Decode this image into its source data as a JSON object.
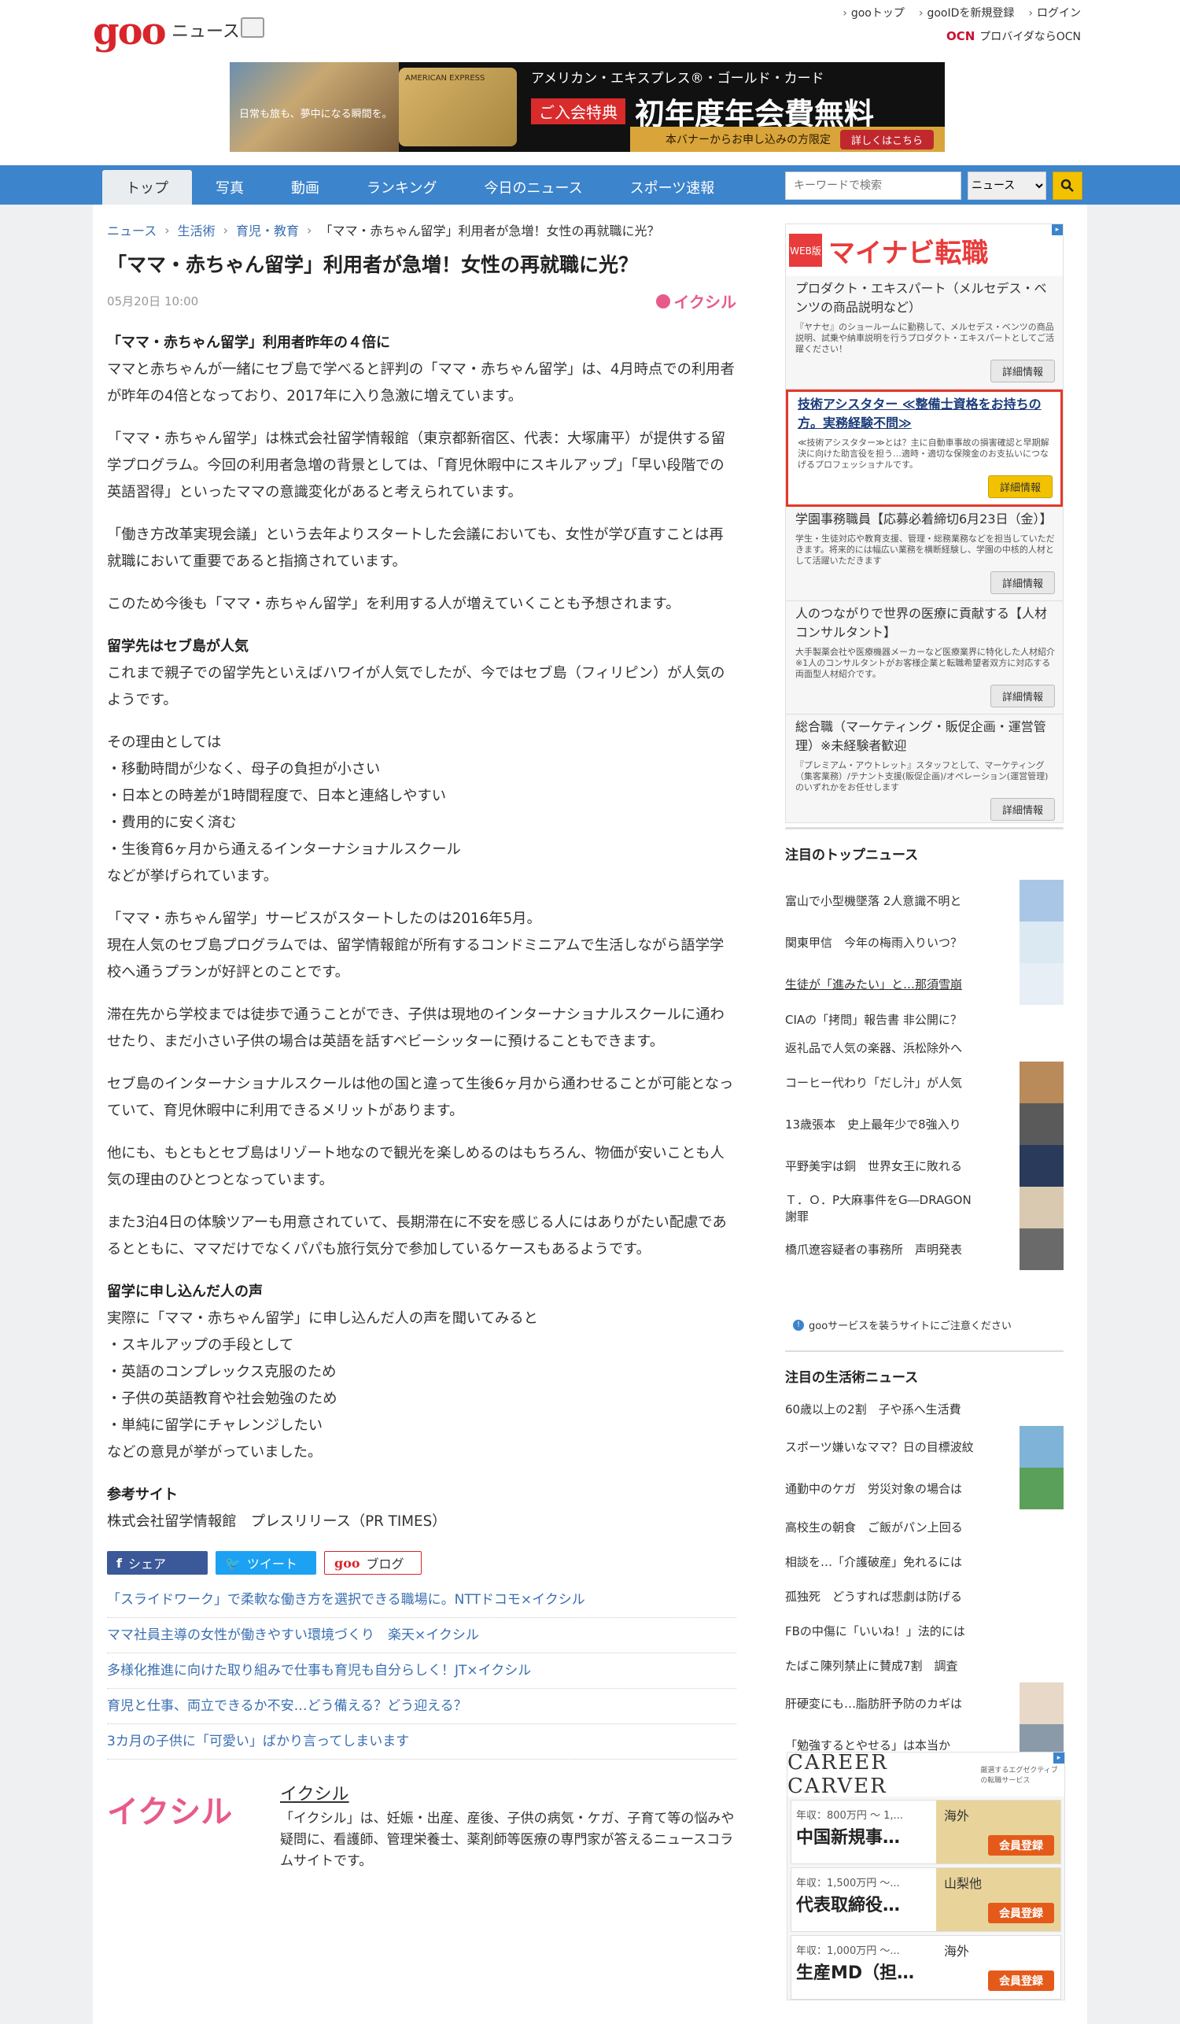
{
  "header": {
    "logo": "goo",
    "section": "ニュース",
    "links": [
      "gooトップ",
      "gooIDを新規登録",
      "ログイン"
    ],
    "ocn_badge": "OCN",
    "ocn_text": "プロバイダならOCN"
  },
  "banner": {
    "img_text": "日常も旅も、夢中になる瞬間を。",
    "card_text": "AMERICAN EXPRESS",
    "line1": "アメリカン・エキスプレス®・ゴールド・カード",
    "tag": "ご入会特典",
    "big": "初年度年会費無料",
    "foot": "本バナーからお申し込みの方限定",
    "button": "詳しくはこちら"
  },
  "nav": {
    "tabs": [
      "トップ",
      "写真",
      "動画",
      "ランキング",
      "今日のニュース",
      "スポーツ速報"
    ],
    "search_placeholder": "キーワードで検索",
    "search_scope": "ニュース"
  },
  "breadcrumb": [
    "ニュース",
    "生活術",
    "育児・教育",
    "「ママ・赤ちゃん留学」利用者が急増！女性の再就職に光？"
  ],
  "article": {
    "title": "「ママ・赤ちゃん留学」利用者が急増！女性の再就職に光？",
    "date": "05月20日 10:00",
    "source": "イクシル",
    "h1": "「ママ・赤ちゃん留学」利用者昨年の４倍に",
    "p1": "ママと赤ちゃんが一緒にセブ島で学べると評判の「ママ・赤ちゃん留学」は、4月時点での利用者が昨年の4倍となっており、2017年に入り急激に増えています。",
    "p2": "「ママ・赤ちゃん留学」は株式会社留学情報館（東京都新宿区、代表：大塚庸平）が提供する留学プログラム。今回の利用者急増の背景としては、「育児休暇中にスキルアップ」「早い段階での英語習得」といったママの意識変化があると考えられています。",
    "p3": "「働き方改革実現会議」という去年よりスタートした会議においても、女性が学び直すことは再就職において重要であると指摘されています。",
    "p4": "このため今後も「ママ・赤ちゃん留学」を利用する人が増えていくことも予想されます。",
    "h2": "留学先はセブ島が人気",
    "p5": "これまで親子での留学先といえばハワイが人気でしたが、今ではセブ島（フィリピン）が人気のようです。",
    "p6_intro": "その理由としては",
    "p6_items": [
      "・移動時間が少なく、母子の負担が小さい",
      "・日本との時差が1時間程度で、日本と連絡しやすい",
      "・費用的に安く済む",
      "・生後育6ヶ月から通えるインターナショナルスクール"
    ],
    "p6_end": "などが挙げられています。",
    "p7a": "「ママ・赤ちゃん留学」サービスがスタートしたのは2016年5月。",
    "p7b": "現在人気のセブ島プログラムでは、留学情報館が所有するコンドミニアムで生活しながら語学学校へ通うプランが好評とのことです。",
    "p8": "滞在先から学校までは徒歩で通うことができ、子供は現地のインターナショナルスクールに通わせたり、まだ小さい子供の場合は英語を話すベビーシッターに預けることもできます。",
    "p9": "セブ島のインターナショナルスクールは他の国と違って生後6ヶ月から通わせることが可能となっていて、育児休暇中に利用できるメリットがあります。",
    "p10": "他にも、もともとセブ島はリゾート地なので観光を楽しめるのはもちろん、物価が安いことも人気の理由のひとつとなっています。",
    "p11": "また3泊4日の体験ツアーも用意されていて、長期滞在に不安を感じる人にはありがたい配慮であるとともに、ママだけでなくパパも旅行気分で参加しているケースもあるようです。",
    "h3": "留学に申し込んだ人の声",
    "p12_intro": "実際に「ママ・赤ちゃん留学」に申し込んだ人の声を聞いてみると",
    "p12_items": [
      "・スキルアップの手段として",
      "・英語のコンプレックス克服のため",
      "・子供の英語教育や社会勉強のため",
      "・単純に留学にチャレンジしたい"
    ],
    "p12_end": "などの意見が挙がっていました。",
    "h4": "参考サイト",
    "ref": "株式会社留学情報館　プレスリリース（PR TIMES）"
  },
  "share": {
    "fb": "シェア",
    "tw": "ツイート",
    "blog_goo": "goo",
    "blog": "ブログ"
  },
  "related": [
    "「スライドワーク」で柔軟な働き方を選択できる職場に。NTTドコモ×イクシル",
    "ママ社員主導の女性が働きやすい環境づくり　楽天×イクシル",
    "多様化推進に向けた取り組みで仕事も育児も自分らしく！JT×イクシル",
    "育児と仕事、両立できるか不安…どう備える？どう迎える？",
    "3カ月の子供に「可愛い」ばかり言ってしまいます"
  ],
  "about": {
    "logo": "イクシル",
    "name": "イクシル",
    "desc": "「イクシル」は、妊娠・出産、産後、子供の病気・ケガ、子育て等の悩みや疑問に、看護師、管理栄養士、薬剤師等医療の専門家が答えるニュースコラムサイトです。"
  },
  "jobs": {
    "badge": "WEB版",
    "logo_a": "マイナビ",
    "logo_b": "転職",
    "items": [
      {
        "title": "プロダクト・エキスパート（メルセデス・ベンツの商品説明など）",
        "desc": "『ヤナセ』のショールームに勤務して、メルセデス・ベンツの商品説明、試乗や納車説明を行うプロダクト・エキスパートとしてご活躍ください！",
        "btn": "詳細情報"
      },
      {
        "title": "技術アシスタター ≪整備士資格をお持ちの方。実務経験不問≫",
        "desc": "≪技術アシスタター≫とは？主に自動車事故の損害確認と早期解決に向けた助言役を担う…適時・適切な保険金のお支払いにつなげるプロフェッショナルです。",
        "btn": "詳細情報"
      },
      {
        "title": "学園事務職員【応募必着締切6月23日（金）】",
        "desc": "学生・生徒対応や教育支援、管理・総務業務などを担当していただきます。将来的には幅広い業務を横断経験し、学園の中核的人材として活躍いただきます",
        "btn": "詳細情報"
      },
      {
        "title": "人のつながりで世界の医療に貢献する【人材コンサルタント】",
        "desc": "大手製薬会社や医療機器メーカーなど医療業界に特化した人材紹介※1人のコンサルタントがお客様企業と転職希望者双方に対応する両面型人材紹介です。",
        "btn": "詳細情報"
      },
      {
        "title": "総合職（マーケティング・販促企画・運営管理）※未経験者歓迎",
        "desc": "『プレミアム・アウトレット』スタッフとして、マーケティング（集客業務）/テナント支援(販促企画)/オペレーション(運営管理)のいずれかをお任せします",
        "btn": "詳細情報"
      }
    ]
  },
  "top_news": {
    "heading": "注目のトップニュース",
    "items": [
      "富山で小型機墜落 2人意識不明と",
      "関東甲信　今年の梅雨入りいつ？",
      "生徒が「進みたい」と…那須雪崩",
      "CIAの「拷問」報告書 非公開に？",
      "返礼品で人気の楽器、浜松除外へ",
      "コーヒー代わり「だし汁」が人気",
      "13歳張本　史上最年少で8強入り",
      "平野美宇は銅　世界女王に敗れる",
      "Ｔ．Ｏ．P大麻事件をG―DRAGON謝罪",
      "橋爪遼容疑者の事務所　声明発表"
    ]
  },
  "goo_note": "gooサービスを装うサイトにご注意ください",
  "life_news": {
    "heading": "注目の生活術ニュース",
    "items": [
      "60歳以上の2割　子や孫へ生活費",
      "スポーツ嫌いなママ？日の目標波紋",
      "通勤中のケガ　労災対象の場合は",
      "高校生の朝食　ご飯がパン上回る",
      "相談を…「介護破産」免れるには",
      "孤独死　どうすれば悲劇は防げる",
      "FBの中傷に「いいね！」法的には",
      "たばこ陳列禁止に賛成7割　調査",
      "肝硬変にも…脂肪肝予防のカギは",
      "「勉強するとやせる」は本当か"
    ]
  },
  "carver": {
    "logo": "CAREER CARVER",
    "sub": "厳選するエグゼクティブの転職サービス",
    "jobs": [
      {
        "salary": "年収：800万円 ～ 1,...",
        "title": "中国新規事…",
        "loc": "海外",
        "btn": "会員登録"
      },
      {
        "salary": "年収：1,500万円 ～...",
        "title": "代表取締役…",
        "loc": "山梨他",
        "btn": "会員登録"
      },
      {
        "salary": "年収：1,000万円 ～...",
        "title": "生産MD（担…",
        "loc": "海外",
        "btn": "会員登録"
      }
    ]
  }
}
